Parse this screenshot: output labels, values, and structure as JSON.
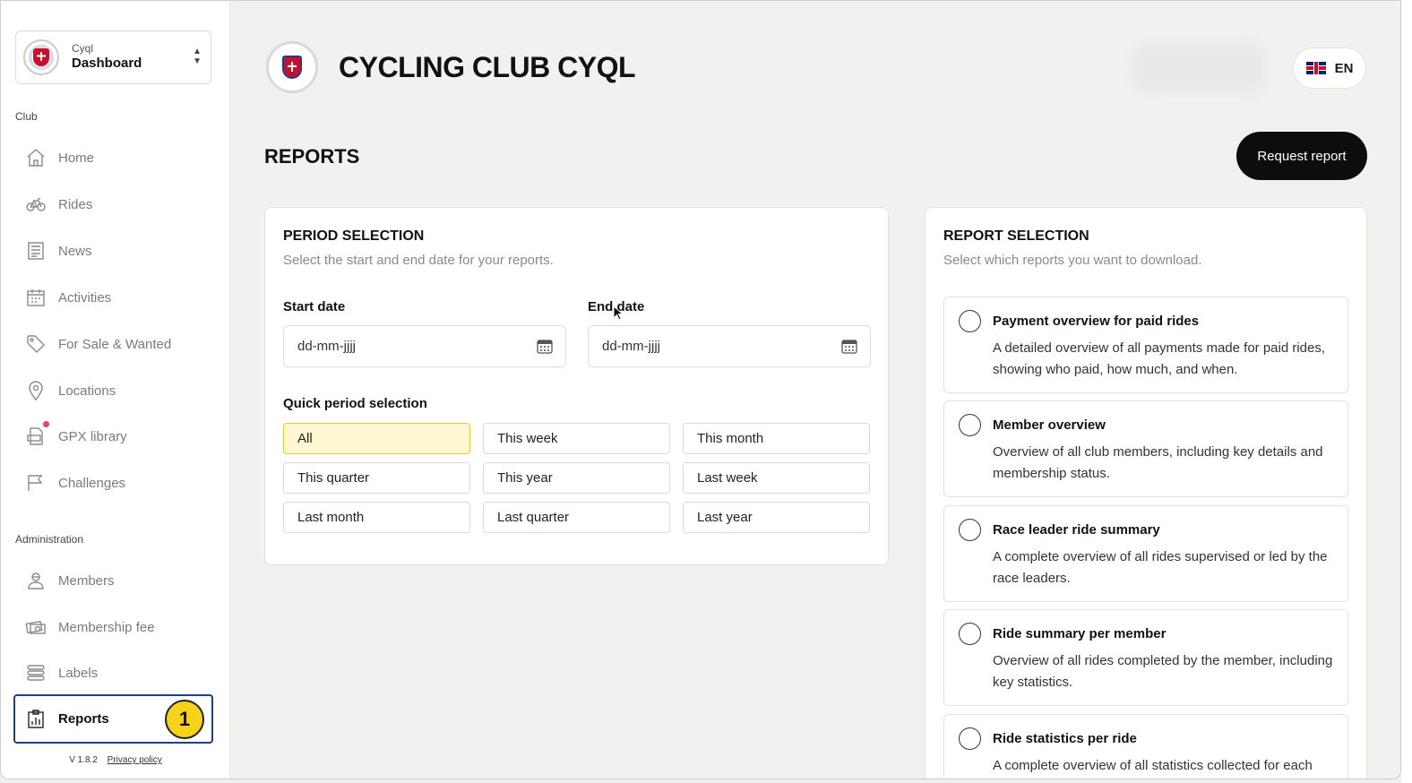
{
  "sidebar": {
    "org": {
      "sub": "Cyql",
      "name": "Dashboard"
    },
    "sections": {
      "club": "Club",
      "admin": "Administration"
    },
    "club_items": [
      {
        "label": "Home",
        "icon": "home-icon"
      },
      {
        "label": "Rides",
        "icon": "bicycle-icon"
      },
      {
        "label": "News",
        "icon": "newspaper-icon"
      },
      {
        "label": "Activities",
        "icon": "calendar-icon"
      },
      {
        "label": "For Sale & Wanted",
        "icon": "tag-icon"
      },
      {
        "label": "Locations",
        "icon": "map-pin-icon"
      },
      {
        "label": "GPX library",
        "icon": "gpx-file-icon"
      },
      {
        "label": "Challenges",
        "icon": "flag-icon"
      }
    ],
    "admin_items": [
      {
        "label": "Members",
        "icon": "member-icon"
      },
      {
        "label": "Membership fee",
        "icon": "money-icon"
      },
      {
        "label": "Labels",
        "icon": "labels-icon"
      },
      {
        "label": "Reports",
        "icon": "report-icon",
        "active": true,
        "badge": "1"
      }
    ],
    "footer": {
      "version": "V 1.8.2",
      "privacy": "Privacy policy"
    }
  },
  "header": {
    "club_title": "CYCLING CLUB CYQL",
    "language": "EN"
  },
  "page": {
    "title": "REPORTS",
    "request_button": "Request report"
  },
  "period": {
    "title": "PERIOD SELECTION",
    "subtitle": "Select the start and end date for your reports.",
    "start_label": "Start date",
    "start_value": "dd-mm-jjjj",
    "end_label": "End date",
    "end_value": "dd-mm-jjjj",
    "quick_label": "Quick period selection",
    "quick_options": [
      "All",
      "This week",
      "This month",
      "This quarter",
      "This year",
      "Last week",
      "Last month",
      "Last quarter",
      "Last year"
    ],
    "selected": "All"
  },
  "reports": {
    "title": "REPORT SELECTION",
    "subtitle": "Select which reports you want to download.",
    "items": [
      {
        "title": "Payment overview for paid rides",
        "desc": "A detailed overview of all payments made for paid rides, showing who paid, how much, and when."
      },
      {
        "title": "Member overview",
        "desc": "Overview of all club members, including key details and membership status."
      },
      {
        "title": "Race leader ride summary",
        "desc": "A complete overview of all rides supervised or led by the race leaders."
      },
      {
        "title": "Ride summary per member",
        "desc": "Overview of all rides completed by the member, including key statistics."
      },
      {
        "title": "Ride statistics per ride",
        "desc": "A complete overview of all statistics collected for each"
      }
    ]
  },
  "colors": {
    "accent": "#1f3d8a",
    "selected_bg": "#fff7d1",
    "badge": "#f7d21a",
    "primary_button": "#0d0d0d"
  }
}
